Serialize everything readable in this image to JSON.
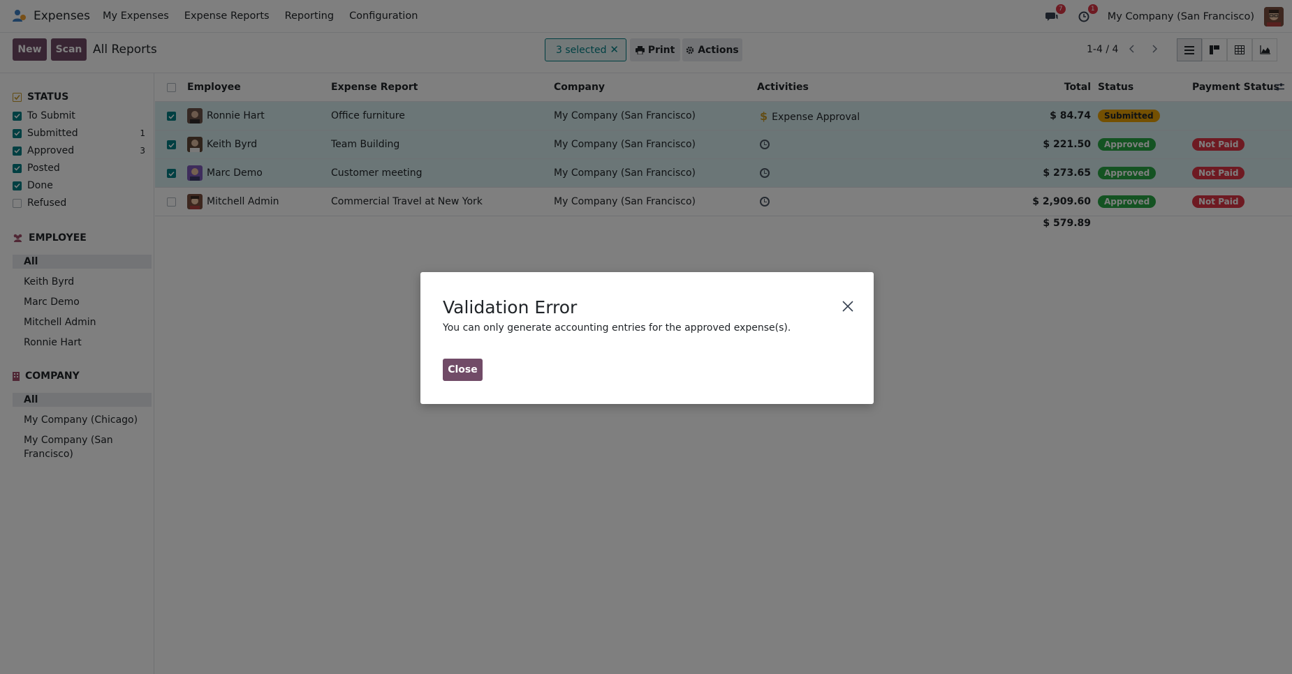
{
  "navbar": {
    "app_name": "Expenses",
    "menu": [
      "My Expenses",
      "Expense Reports",
      "Reporting",
      "Configuration"
    ],
    "messages_count": "7",
    "activities_count": "1",
    "company": "My Company (San Francisco)"
  },
  "control_panel": {
    "new_label": "New",
    "scan_label": "Scan",
    "title": "All Reports",
    "selected_label": "3 selected",
    "print_label": "Print",
    "actions_label": "Actions",
    "pager": "1-4 / 4"
  },
  "sidebar": {
    "status_heading": "STATUS",
    "statuses": [
      {
        "label": "To Submit",
        "checked": true,
        "count": ""
      },
      {
        "label": "Submitted",
        "checked": true,
        "count": "1"
      },
      {
        "label": "Approved",
        "checked": true,
        "count": "3"
      },
      {
        "label": "Posted",
        "checked": true,
        "count": ""
      },
      {
        "label": "Done",
        "checked": true,
        "count": ""
      },
      {
        "label": "Refused",
        "checked": false,
        "count": ""
      }
    ],
    "employee_heading": "EMPLOYEE",
    "employees": [
      "All",
      "Keith Byrd",
      "Marc Demo",
      "Mitchell Admin",
      "Ronnie Hart"
    ],
    "company_heading": "COMPANY",
    "companies": [
      "All",
      "My Company (Chicago)",
      "My Company (San Francisco)"
    ]
  },
  "table": {
    "headers": {
      "employee": "Employee",
      "report": "Expense Report",
      "company": "Company",
      "activities": "Activities",
      "total": "Total",
      "status": "Status",
      "payment": "Payment Status"
    },
    "rows": [
      {
        "employee": "Ronnie Hart",
        "report": "Office furniture",
        "company": "My Company (San Francisco)",
        "activity": "Expense Approval",
        "total": "$ 84.74",
        "status": "Submitted",
        "payment": ""
      },
      {
        "employee": "Keith Byrd",
        "report": "Team Building",
        "company": "My Company (San Francisco)",
        "activity": "",
        "total": "$ 221.50",
        "status": "Approved",
        "payment": "Not Paid"
      },
      {
        "employee": "Marc Demo",
        "report": "Customer meeting",
        "company": "My Company (San Francisco)",
        "activity": "",
        "total": "$ 273.65",
        "status": "Approved",
        "payment": "Not Paid"
      },
      {
        "employee": "Mitchell Admin",
        "report": "Commercial Travel at New York",
        "company": "My Company (San Francisco)",
        "activity": "",
        "total": "$ 2,909.60",
        "status": "Approved",
        "payment": "Not Paid"
      }
    ],
    "grand_total": "$ 579.89"
  },
  "dialog": {
    "title": "Validation Error",
    "message": "You can only generate accounting entries for the approved expense(s).",
    "close_label": "Close"
  },
  "colors": {
    "brand": "#714B67",
    "accent": "#017e84",
    "submitted": "#e9a005",
    "approved": "#28a745",
    "not_paid": "#dc3545"
  }
}
